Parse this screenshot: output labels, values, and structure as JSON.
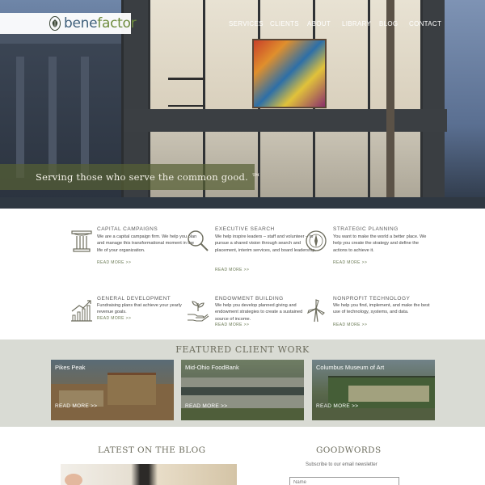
{
  "header": {
    "logo": {
      "part1": "bene",
      "part2": "factor",
      "icon": "oak-leaf-icon"
    },
    "nav": [
      "SERVICES",
      "CLIENTS",
      "ABOUT",
      "LIBRARY",
      "BLOG",
      "CONTACT"
    ]
  },
  "hero": {
    "tagline": "Serving those who serve the common good. ™"
  },
  "services": [
    {
      "icon": "column-icon",
      "title": "CAPITAL CAMPAIGNS",
      "desc": "We are a capital campaign firm. We help you plan and manage this transformational moment in the life of your organization.",
      "more": "READ MORE >>"
    },
    {
      "icon": "magnifier-icon",
      "title": "EXECUTIVE SEARCH",
      "desc": "We help inspire leaders – staff and volunteer – to pursue a shared vision through search and placement, interim services, and board leadership.",
      "more": "READ MORE >>"
    },
    {
      "icon": "compass-icon",
      "title": "STRATEGIC PLANNING",
      "desc": "You want to make the world a better place. We help you create the strategy and define the actions to achieve it.",
      "more": "READ MORE >>"
    },
    {
      "icon": "growth-chart-icon",
      "title": "GENERAL DEVELOPMENT",
      "desc": "Fundraising plans that achieve your yearly revenue goals.",
      "more": "READ MORE >>"
    },
    {
      "icon": "sprout-hand-icon",
      "title": "ENDOWMENT BUILDING",
      "desc": "We help you develop planned giving and endowment strategies to create a sustained source of income.",
      "more": "READ MORE >>"
    },
    {
      "icon": "windmill-icon",
      "title": "NONPROFIT TECHNOLOGY",
      "desc": "We help you find, implement, and make the best use of technology, systems, and data.",
      "more": "READ MORE >>"
    }
  ],
  "featured": {
    "title": "FEATURED CLIENT WORK",
    "cards": [
      {
        "name": "Pikes Peak",
        "more": "READ MORE >>"
      },
      {
        "name": "Mid-Ohio FoodBank",
        "more": "READ MORE >>"
      },
      {
        "name": "Columbus Museum of Art",
        "more": "READ MORE >>"
      }
    ]
  },
  "blog": {
    "title": "LATEST ON THE BLOG"
  },
  "goodwords": {
    "title": "GOODWORDS",
    "subscribe": "Subscribe to our email newsletter",
    "email_placeholder": "Name"
  }
}
